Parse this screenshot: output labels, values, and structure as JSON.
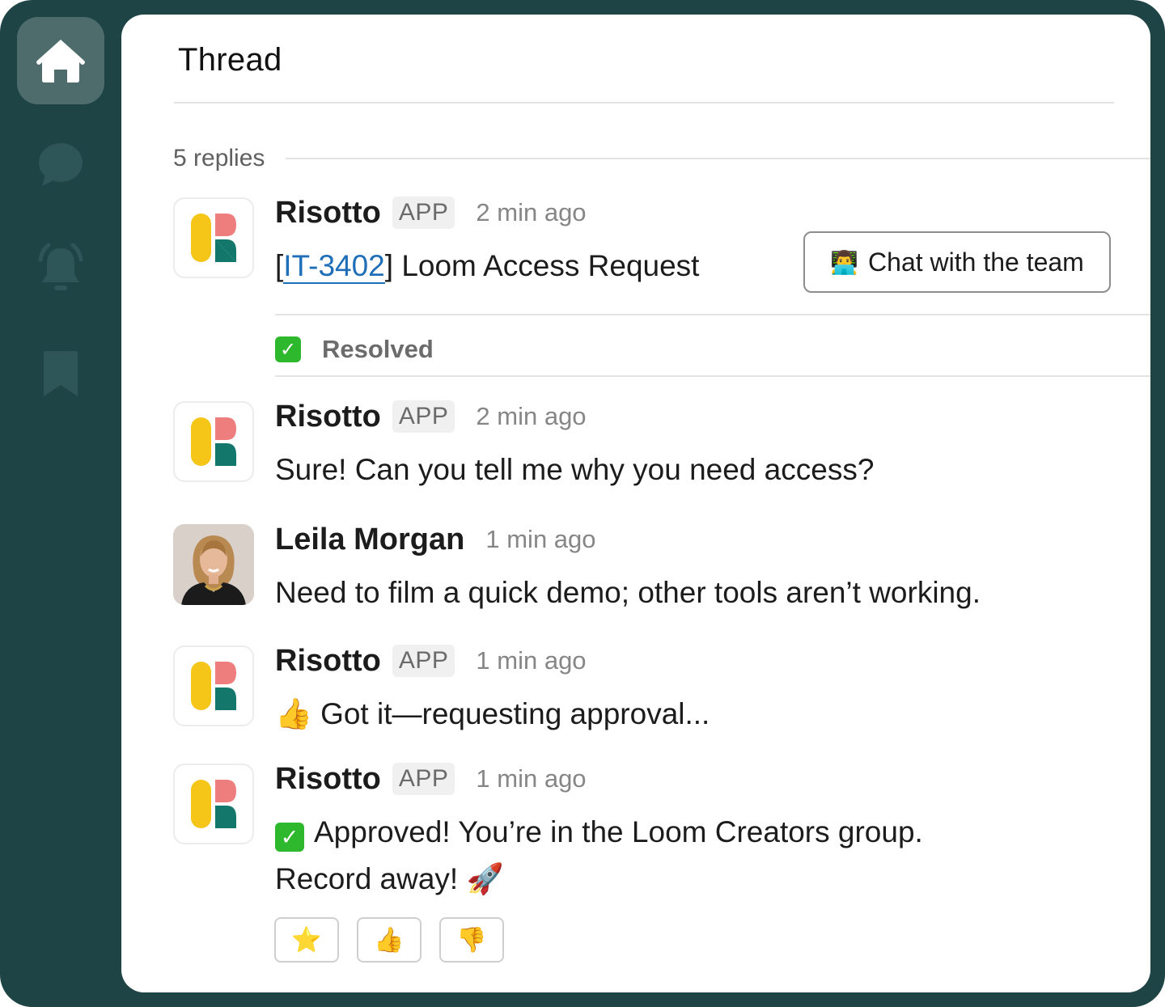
{
  "sidebar": {
    "items": [
      {
        "icon": "home-icon",
        "active": true
      },
      {
        "icon": "chat-bubble-icon",
        "active": false
      },
      {
        "icon": "bell-icon",
        "active": false
      },
      {
        "icon": "bookmark-icon",
        "active": false
      }
    ]
  },
  "thread": {
    "title": "Thread",
    "replies_label": "5 replies"
  },
  "messages": [
    {
      "sender": "Risotto",
      "badge": "APP",
      "time": "2 min ago",
      "text_prefix": "[",
      "ticket_link": "IT-3402",
      "text_suffix": "] Loom Access Request",
      "action_button": {
        "emoji": "👨‍💻",
        "label": "Chat with the team"
      },
      "status": {
        "label": "Resolved"
      }
    },
    {
      "sender": "Risotto",
      "badge": "APP",
      "time": "2 min ago",
      "text": "Sure! Can you tell me why you need access?"
    },
    {
      "sender": "Leila Morgan",
      "time": "1 min ago",
      "text": "Need to film a quick demo; other tools aren’t working."
    },
    {
      "sender": "Risotto",
      "badge": "APP",
      "time": "1 min ago",
      "emoji": "👍",
      "text": "Got it—requesting approval..."
    },
    {
      "sender": "Risotto",
      "badge": "APP",
      "time": "1 min ago",
      "text_line1": "Approved! You’re in the Loom Creators group.",
      "text_line2": "Record away!",
      "emoji_end": "🚀",
      "reactions": [
        "⭐",
        "👍",
        "👎"
      ]
    }
  ],
  "colors": {
    "sidebar_bg": "#1f4446",
    "logo_yellow": "#f5c518",
    "logo_pink": "#ee7d7d",
    "logo_teal": "#14776c",
    "link_blue": "#1f6fb8",
    "check_green": "#2eb82e"
  }
}
